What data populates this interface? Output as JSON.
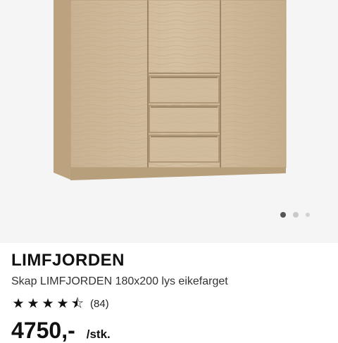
{
  "gallery": {
    "slide_count": 3,
    "active_slide": 1
  },
  "product": {
    "title": "LIMFJORDEN",
    "subtitle": "Skap LIMFJORDEN 180x200 lys eikefarget",
    "rating": {
      "stars": 4.5,
      "star_glyphs": [
        "★",
        "★",
        "★",
        "★",
        "⯪"
      ],
      "count": "(84)"
    },
    "price": "4750,-",
    "unit": "/stk."
  },
  "colors": {
    "gallery_bg": "#f5f5f5",
    "wood": "#cdb898",
    "text": "#111111"
  }
}
